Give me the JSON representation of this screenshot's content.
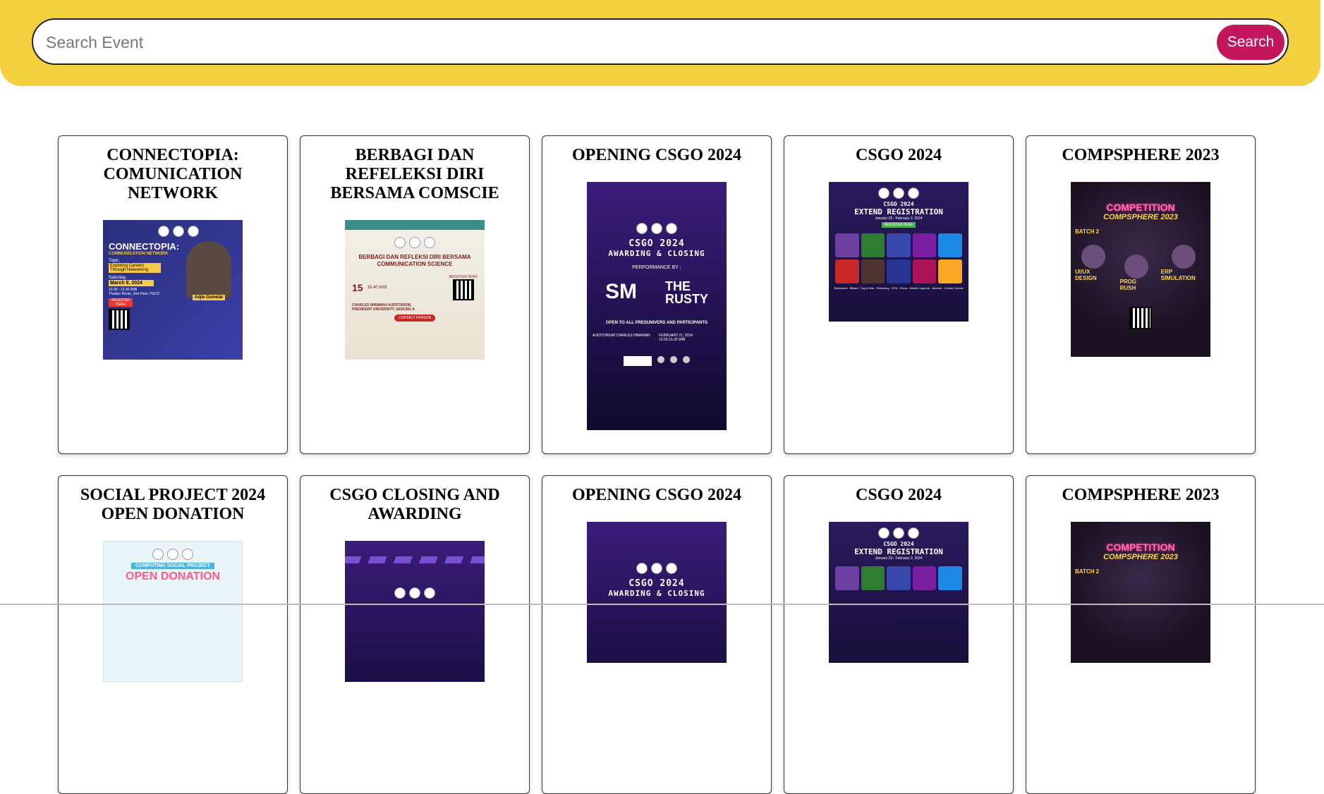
{
  "search": {
    "placeholder": "Search Event",
    "button_label": "Search"
  },
  "colors": {
    "header_bg": "#f4d03f",
    "search_button_bg": "#c2185b"
  },
  "events": [
    {
      "title": "CONNECTOPIA: COMUNICATION NETWORK",
      "poster": {
        "headline": "CONNECTOPIA:",
        "subhead": "COMMUNICATION NETWORK",
        "topic_label": "Topic:",
        "topic": "Exploring Careers Through Networking",
        "day": "Saturday,",
        "date": "March 9, 2024",
        "time": "10.00 - 12.30 WIB",
        "place": "Theater Room, 2nd Floor, PUCC",
        "register": "REGISTER HERE",
        "speaker": "Adjie Gumelar"
      }
    },
    {
      "title": "BERBAGI DAN REFELEKSI DIRI BERSAMA COMSCIE",
      "poster": {
        "headline": "BERBAGI DAN REFLEKSI DIRI BERSAMA COMMUNICATION SCIENCE",
        "date": "15",
        "time": "16.40 WIB",
        "place": "CHARLES HIMAWAN AUDITORIUM, PRESIDENT UNIVERSITY, GEDUNG A",
        "register": "REGISTER NOW!",
        "contact": "CONTACT PERSON"
      }
    },
    {
      "title": "OPENING CSGO 2024",
      "poster": {
        "headline": "CSGO 2024",
        "subhead": "AWARDING & CLOSING",
        "performance": "PERFORMANCE BY :",
        "open_to": "OPEN TO ALL PRESUNIVERS AND PARTICIPANTS",
        "place": "AUDITORIUM CHARLES HIMAWAN",
        "date": "FEBRUARY 21, 2024",
        "time": "13.00-15.30 WIB"
      }
    },
    {
      "title": "CSGO 2024",
      "poster": {
        "headline": "CSGO 2024",
        "subhead": "EXTEND REGISTRATION",
        "dates": "January 29 - February 2, 2024",
        "register": "REGISTER HERE",
        "games": [
          "Badminton",
          "Billiard",
          "Tug of War",
          "Swimming",
          "FIFA",
          "Chess",
          "Mobile Legends",
          "Valorant",
          "Cerdas Cermat"
        ]
      }
    },
    {
      "title": "COMPSPHERE 2023",
      "poster": {
        "headline": "COMPETITION",
        "subhead": "COMPSPHERE 2023",
        "batch": "BATCH 2",
        "items": [
          "UI/UX DESIGN",
          "PROG RUSH",
          "ERP SIMULATION"
        ]
      }
    },
    {
      "title": "SOCIAL PROJECT 2024 OPEN DONATION",
      "poster": {
        "kicker": "COMPUTING SOCIAL PROJECT",
        "headline": "OPEN DONATION"
      }
    },
    {
      "title": "CSGO CLOSING AND AWARDING",
      "poster": {}
    },
    {
      "title": "OPENING CSGO 2024",
      "poster": {
        "headline": "CSGO 2024",
        "subhead": "AWARDING & CLOSING"
      }
    },
    {
      "title": "CSGO 2024",
      "poster": {
        "headline": "CSGO 2024",
        "subhead": "EXTEND REGISTRATION",
        "dates": "January 29 - February 2, 2024"
      }
    },
    {
      "title": "COMPSPHERE 2023",
      "poster": {
        "headline": "COMPETITION",
        "subhead": "COMPSPHERE 2023",
        "batch": "BATCH 2"
      }
    }
  ]
}
